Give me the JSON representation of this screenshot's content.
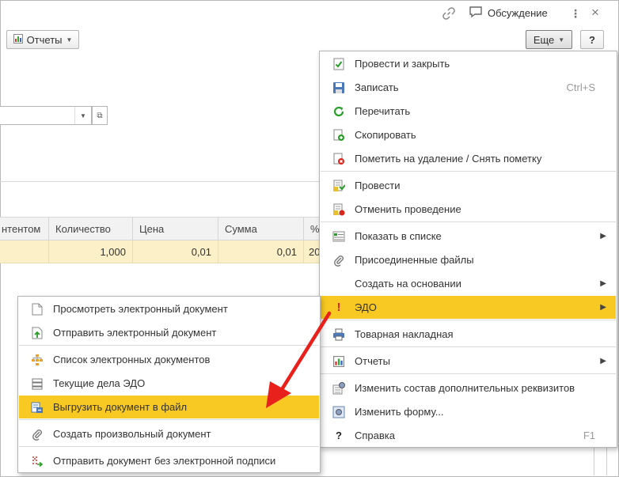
{
  "topbar": {
    "discuss_label": "Обсуждение"
  },
  "toolbar": {
    "reports_label": "Отчеты",
    "more_label": "Еще",
    "help_label": "?"
  },
  "table": {
    "columns": [
      "нтентом",
      "Количество",
      "Цена",
      "Сумма",
      "%"
    ],
    "row": [
      "",
      "1,000",
      "0,01",
      "0,01",
      "20"
    ]
  },
  "main_menu": {
    "items": [
      {
        "label": "Провести и закрыть",
        "icon": "post-close-icon"
      },
      {
        "label": "Записать",
        "icon": "save-icon",
        "shortcut": "Ctrl+S"
      },
      {
        "label": "Перечитать",
        "icon": "reload-icon"
      },
      {
        "label": "Скопировать",
        "icon": "copy-icon"
      },
      {
        "label": "Пометить на удаление / Снять пометку",
        "icon": "mark-delete-icon"
      },
      {
        "label": "Провести",
        "icon": "post-icon"
      },
      {
        "label": "Отменить проведение",
        "icon": "unpost-icon"
      },
      {
        "label": "Показать в списке",
        "icon": "list-icon"
      },
      {
        "label": "Присоединенные файлы",
        "icon": "paperclip-icon"
      },
      {
        "label": "Создать на основании",
        "icon": ""
      },
      {
        "label": "ЭДО",
        "icon": "exclamation-icon"
      },
      {
        "label": "Товарная накладная",
        "icon": "printer-icon"
      },
      {
        "label": "Отчеты",
        "icon": "reports-icon"
      },
      {
        "label": "Изменить состав дополнительных реквизитов",
        "icon": "attributes-icon"
      },
      {
        "label": "Изменить форму...",
        "icon": "form-icon"
      },
      {
        "label": "Справка",
        "icon": "help-icon",
        "shortcut": "F1"
      }
    ]
  },
  "sub_menu": {
    "items": [
      {
        "label": "Просмотреть электронный документ",
        "icon": "document-icon"
      },
      {
        "label": "Отправить электронный документ",
        "icon": "send-document-icon"
      },
      {
        "label": "Список электронных документов",
        "icon": "doc-list-icon"
      },
      {
        "label": "Текущие дела ЭДО",
        "icon": "tasks-icon"
      },
      {
        "label": "Выгрузить документ в файл",
        "icon": "export-file-icon"
      },
      {
        "label": "Создать произвольный документ",
        "icon": "paperclip-icon"
      },
      {
        "label": "Отправить документ без электронной подписи",
        "icon": "send-unsigned-icon"
      }
    ]
  },
  "colors": {
    "highlight": "#f8c922",
    "row_highlight": "#fbf0c7",
    "arrow": "#e8211d"
  }
}
